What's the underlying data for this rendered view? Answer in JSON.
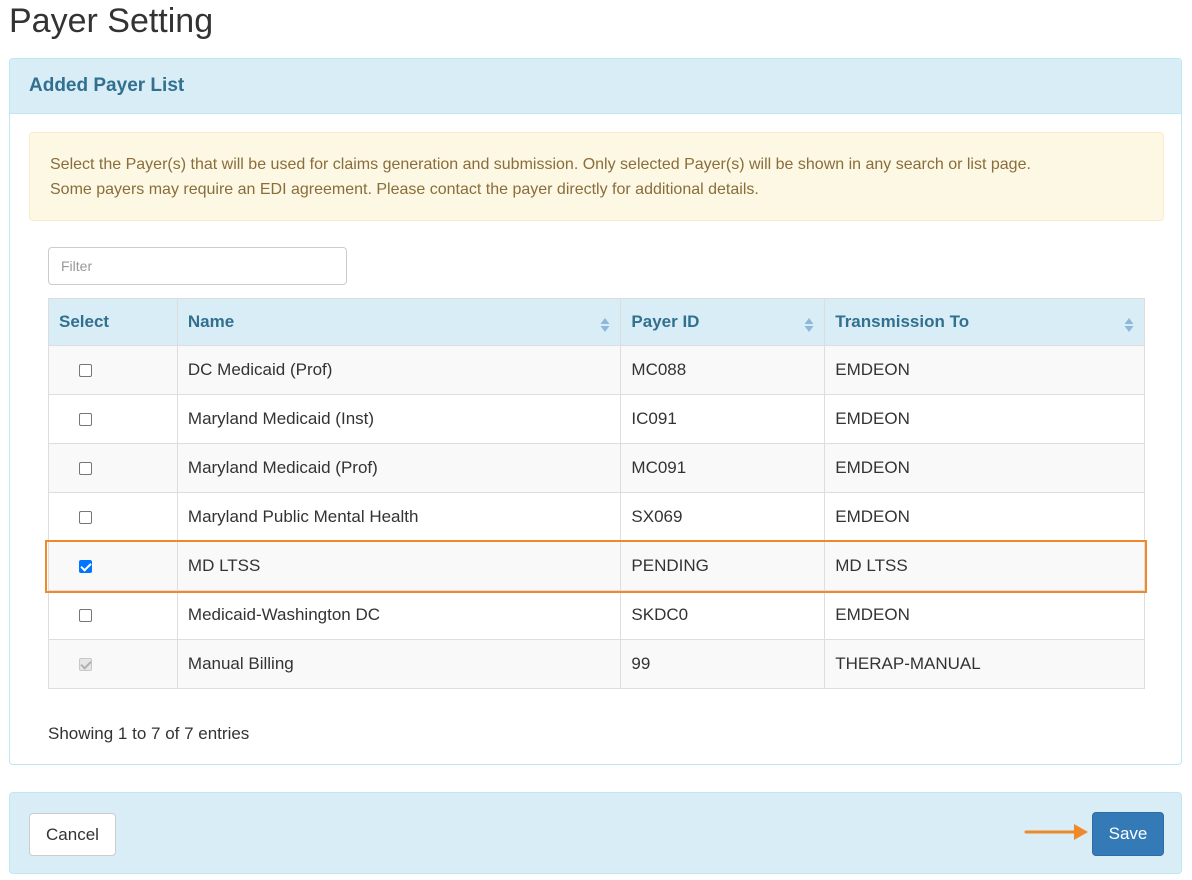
{
  "page": {
    "title": "Payer Setting"
  },
  "panel": {
    "title": "Added Payer List",
    "notice_line1": "Select the Payer(s) that will be used for claims generation and submission. Only selected Payer(s) will be shown in any search or list page.",
    "notice_line2": "Some payers may require an EDI agreement. Please contact the payer directly for additional details."
  },
  "filter": {
    "placeholder": "Filter",
    "value": ""
  },
  "table": {
    "columns": [
      "Select",
      "Name",
      "Payer ID",
      "Transmission To"
    ],
    "rows": [
      {
        "checked": false,
        "disabled": false,
        "name": "DC Medicaid (Prof)",
        "payer_id": "MC088",
        "transmission_to": "EMDEON"
      },
      {
        "checked": false,
        "disabled": false,
        "name": "Maryland Medicaid (Inst)",
        "payer_id": "IC091",
        "transmission_to": "EMDEON"
      },
      {
        "checked": false,
        "disabled": false,
        "name": "Maryland Medicaid (Prof)",
        "payer_id": "MC091",
        "transmission_to": "EMDEON"
      },
      {
        "checked": false,
        "disabled": false,
        "name": "Maryland Public Mental Health",
        "payer_id": "SX069",
        "transmission_to": "EMDEON"
      },
      {
        "checked": true,
        "disabled": false,
        "name": "MD LTSS",
        "payer_id": "PENDING",
        "transmission_to": "MD LTSS"
      },
      {
        "checked": false,
        "disabled": false,
        "name": "Medicaid-Washington DC",
        "payer_id": "SKDC0",
        "transmission_to": "EMDEON"
      },
      {
        "checked": true,
        "disabled": true,
        "name": "Manual Billing",
        "payer_id": "99",
        "transmission_to": "THERAP-MANUAL"
      }
    ],
    "info": "Showing 1 to 7 of 7 entries"
  },
  "footer": {
    "cancel_label": "Cancel",
    "save_label": "Save"
  },
  "colors": {
    "panel_heading_bg": "#d9edf7",
    "panel_title": "#31708f",
    "alert_bg": "#fcf8e3",
    "alert_text": "#8a6d3b",
    "primary": "#337ab7",
    "highlight": "#f0892a",
    "sort_icon": "#8fb8d8"
  }
}
